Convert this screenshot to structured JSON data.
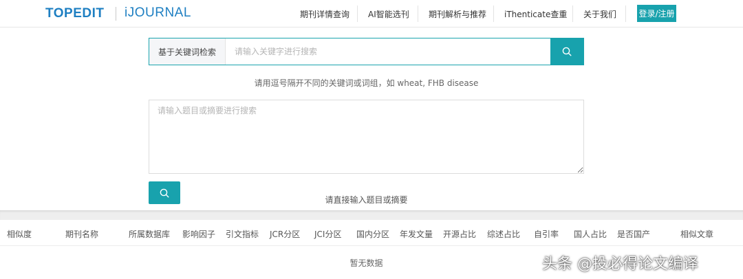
{
  "header": {
    "logo_topedit": "TOPEDIT",
    "logo_ijournal": "iJOURNAL",
    "nav": [
      "期刊详情查询",
      "AI智能选刊",
      "期刊解析与推荐",
      "iThenticate查重",
      "关于我们"
    ],
    "login": "登录/注册"
  },
  "search": {
    "type_label": "基于关键词检索",
    "placeholder": "请输入关键字进行搜索",
    "hint": "请用逗号隔开不同的关键词或词组，如 wheat, FHB disease",
    "textarea_placeholder": "请输入题目或摘要进行搜索",
    "hint2": "请直接输入题目或摘要"
  },
  "table": {
    "columns": [
      "相似度",
      "期刊名称",
      "所属数据库",
      "影响因子",
      "引文指标",
      "JCR分区",
      "JCI分区",
      "国内分区",
      "年发文量",
      "开源占比",
      "综述占比",
      "自引率",
      "国人占比",
      "是否国产",
      "相似文章"
    ],
    "empty_text": "暂无数据"
  },
  "watermark": "头条 @投必得论文编译",
  "colors": {
    "accent": "#18a2ad",
    "brand": "#1e7fc2"
  }
}
